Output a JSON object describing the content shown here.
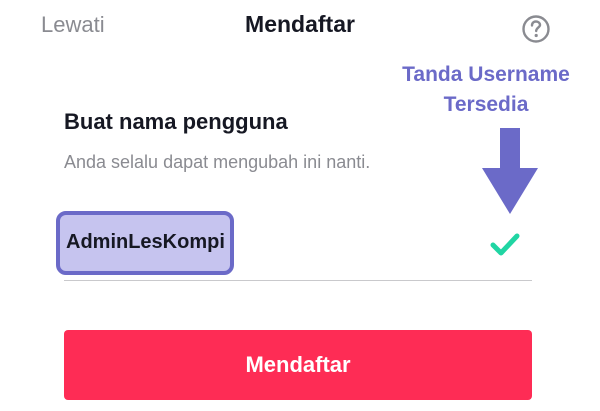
{
  "header": {
    "skip_label": "Lewati",
    "title": "Mendaftar",
    "help_icon": "question-circle-icon"
  },
  "annotation": {
    "label_line1": "Tanda Username",
    "label_line2": "Tersedia",
    "color": "#6b6ac8",
    "arrow_icon": "arrow-down-icon"
  },
  "form": {
    "heading": "Buat nama pengguna",
    "subtext": "Anda selalu dapat mengubah ini nanti.",
    "username_value": "AdminLesKompi",
    "available_icon": "checkmark-icon",
    "available_color": "#20d5a3"
  },
  "actions": {
    "submit_label": "Mendaftar",
    "submit_color": "#fe2c55"
  }
}
